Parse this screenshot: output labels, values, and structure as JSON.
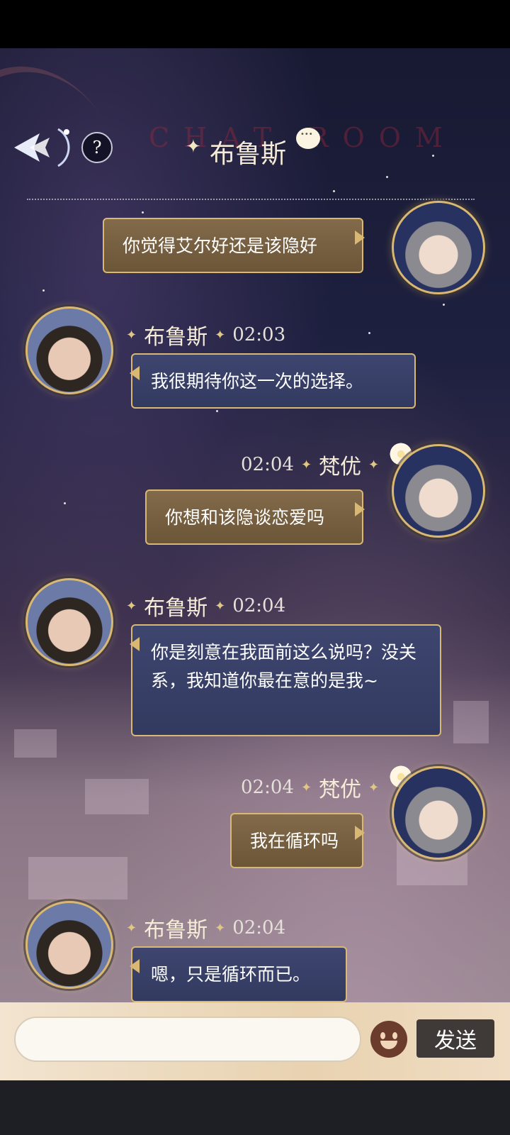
{
  "header": {
    "title": "布鲁斯",
    "background_title": "CHAT ROOM",
    "help_label": "?"
  },
  "messages": [
    {
      "side": "right",
      "sender": "",
      "time": "",
      "text": "你觉得艾尔好还是该隐好"
    },
    {
      "side": "left",
      "sender": "布鲁斯",
      "time": "02:03",
      "text": "我很期待你这一次的选择。"
    },
    {
      "side": "right",
      "sender": "梵优",
      "time": "02:04",
      "text": "你想和该隐谈恋爱吗"
    },
    {
      "side": "left",
      "sender": "布鲁斯",
      "time": "02:04",
      "text": "你是刻意在我面前这么说吗？没关系，我知道你最在意的是我~"
    },
    {
      "side": "right",
      "sender": "梵优",
      "time": "02:04",
      "text": "我在循环吗"
    },
    {
      "side": "left",
      "sender": "布鲁斯",
      "time": "02:04",
      "text": "嗯，只是循环而已。"
    }
  ],
  "input": {
    "value": "",
    "placeholder": ""
  },
  "send_label": "发送",
  "colors": {
    "accent_gold": "#d9b873",
    "self_bubble": "#7a6344",
    "other_bubble": "#3a4268"
  }
}
